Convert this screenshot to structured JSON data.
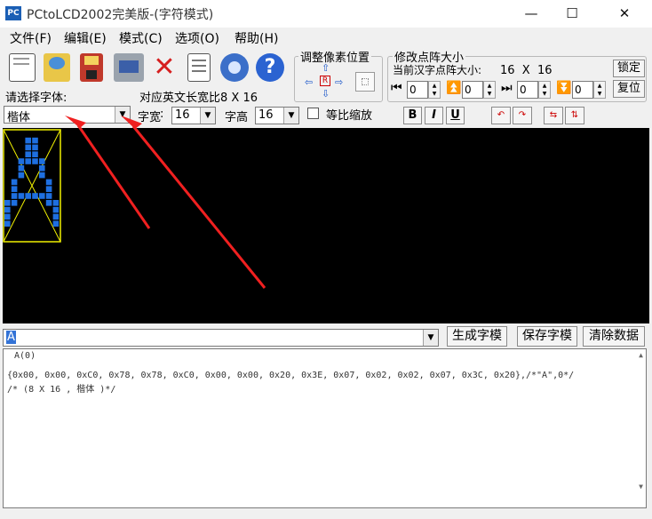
{
  "window": {
    "title": "PCtoLCD2002完美版-(字符模式)",
    "icon_text": "PC"
  },
  "menu": [
    {
      "label": "文件(F)"
    },
    {
      "label": "编辑(E)"
    },
    {
      "label": "模式(C)"
    },
    {
      "label": "选项(O)"
    },
    {
      "label": "帮助(H)"
    }
  ],
  "toolbar_icons": [
    "new-file-icon",
    "open-folder-icon",
    "save-disk-icon",
    "print-icon",
    "delete-x-icon",
    "notes-icon",
    "gear-icon",
    "help-icon"
  ],
  "font_section": {
    "label": "请选择字体:",
    "font_value": "楷体",
    "ratio_text": "对应英文长宽比8 X 16",
    "width_label": "字宽",
    "width_value": "16",
    "height_label": "字高",
    "height_value": "16",
    "proportional_label": "等比缩放",
    "proportional_checked": false
  },
  "adjust_position": {
    "title": "调整像素位置",
    "center_label": "R"
  },
  "matrix_size": {
    "title": "修改点阵大小",
    "current_label": "当前汉字点阵大小:",
    "current_value": "16  X  16",
    "lock_label": "锁定",
    "reset_label": "复位",
    "spinners": [
      "0",
      "0",
      "0",
      "0"
    ]
  },
  "format_buttons": [
    "B",
    "I",
    "U"
  ],
  "input": {
    "text": "A"
  },
  "actions": {
    "generate_label": "生成字模",
    "save_label": "保存字模",
    "clear_label": "清除数据"
  },
  "output": {
    "line1": " A(0)",
    "line2": "{0x00, 0x00, 0xC0, 0x78, 0x78, 0xC0, 0x00, 0x00, 0x20, 0x3E, 0x07, 0x02, 0x02, 0x07, 0x3C, 0x20},/*\"A\",0*/",
    "line3": "/* (8 X 16 , 楷体 )*/"
  },
  "colors": {
    "canvas_bg": "#000000",
    "pixel_on": "#1e6fe0",
    "preview_border": "#f0f000",
    "arrow_red": "#f02020"
  }
}
